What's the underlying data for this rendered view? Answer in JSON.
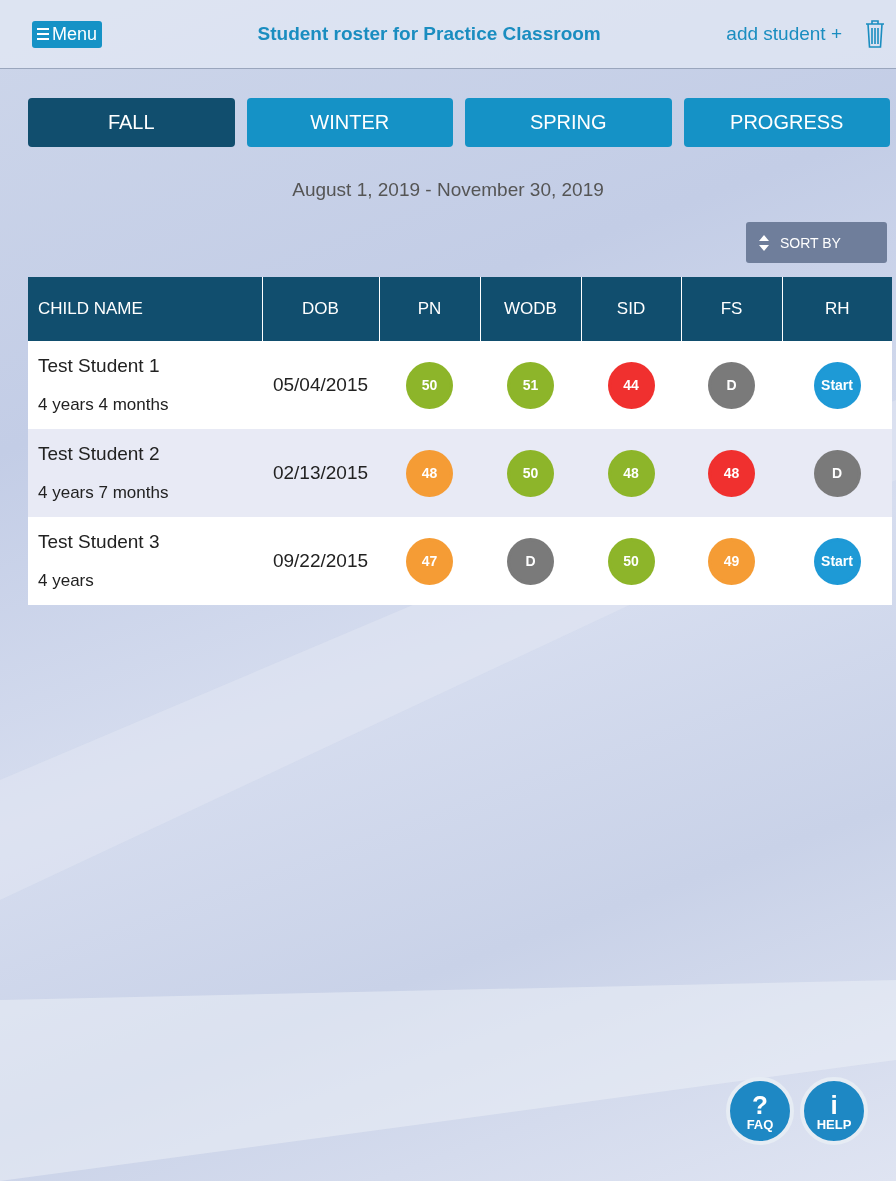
{
  "header": {
    "menu_button": "Menu",
    "title": "Student roster for Practice Classroom",
    "add_link": "add student +"
  },
  "tabs": [
    {
      "label": "FALL",
      "selected": true
    },
    {
      "label": "WINTER",
      "selected": false
    },
    {
      "label": "SPRING",
      "selected": false
    },
    {
      "label": "PROGRESS",
      "selected": false
    }
  ],
  "date_range": "August 1, 2019 - November 30, 2019",
  "sort_button": "SORT BY",
  "table": {
    "columns": [
      "CHILD NAME",
      "DOB",
      "PN",
      "WODB",
      "SID",
      "FS",
      "RH"
    ],
    "rows": [
      {
        "name": "Test Student 1",
        "age": "4 years 4 months",
        "dob": "05/04/2015",
        "scores": [
          {
            "text": "50",
            "color": "#8db52a"
          },
          {
            "text": "51",
            "color": "#8db52a"
          },
          {
            "text": "44",
            "color": "#f0302f"
          },
          {
            "text": "D",
            "color": "#7a7a7a"
          },
          {
            "text": "Start",
            "color": "#1e9ad6"
          }
        ]
      },
      {
        "name": "Test Student 2",
        "age": "4 years 7 months",
        "dob": "02/13/2015",
        "scores": [
          {
            "text": "48",
            "color": "#f59c35"
          },
          {
            "text": "50",
            "color": "#8db52a"
          },
          {
            "text": "48",
            "color": "#8db52a"
          },
          {
            "text": "48",
            "color": "#f0302f"
          },
          {
            "text": "D",
            "color": "#7a7a7a"
          }
        ]
      },
      {
        "name": "Test Student 3",
        "age": "4 years",
        "dob": "09/22/2015",
        "scores": [
          {
            "text": "47",
            "color": "#f59c35"
          },
          {
            "text": "D",
            "color": "#7a7a7a"
          },
          {
            "text": "50",
            "color": "#8db52a"
          },
          {
            "text": "49",
            "color": "#f59c35"
          },
          {
            "text": "Start",
            "color": "#1e9ad6"
          }
        ]
      }
    ]
  },
  "help_buttons": [
    {
      "symbol": "?",
      "label": "FAQ"
    },
    {
      "symbol": "i",
      "label": "HELP"
    }
  ]
}
